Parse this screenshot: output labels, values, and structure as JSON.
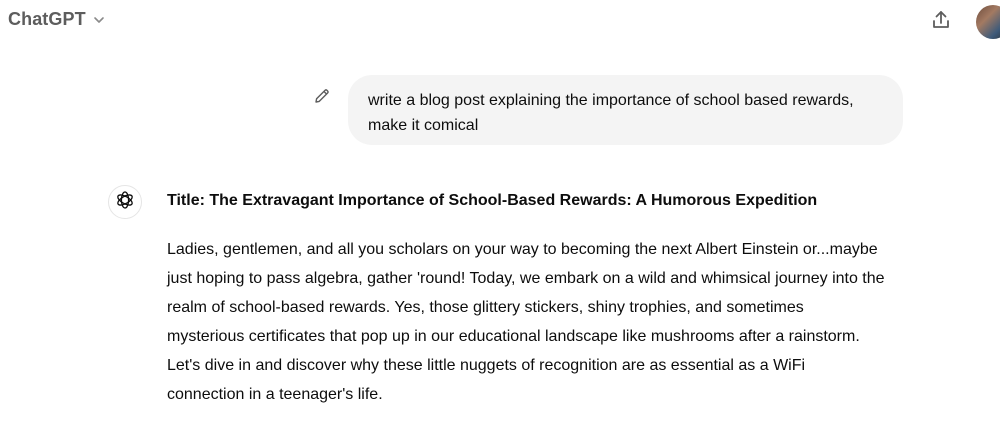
{
  "header": {
    "model_name": "ChatGPT",
    "switcher_icon": "chevron-down-icon",
    "share_icon": "share-icon",
    "avatar_icon": "user-avatar"
  },
  "conversation": {
    "user_message": {
      "edit_icon": "pencil-icon",
      "lines": [
        "write a blog post explaining the importance of school based rewards,",
        "make it comical"
      ]
    },
    "assistant_message": {
      "icon": "openai-logo-icon",
      "title": "Title: The Extravagant Importance of School-Based Rewards: A Humorous Expedition",
      "paragraph_lines": [
        "Ladies, gentlemen, and all you scholars on your way to becoming the next Albert Einstein or...maybe",
        "just hoping to pass algebra, gather 'round! Today, we embark on a wild and whimsical journey into the",
        "realm of school-based rewards. Yes, those glittery stickers, shiny trophies, and sometimes",
        "mysterious certificates that pop up in our educational landscape like mushrooms after a rainstorm.",
        "Let's dive in and discover why these little nuggets of recognition are as essential as a WiFi",
        "connection in a teenager's life."
      ]
    }
  },
  "colors": {
    "bubble_bg": "#f4f4f4",
    "text": "#0d0d0d",
    "muted": "#5d5d5d"
  }
}
